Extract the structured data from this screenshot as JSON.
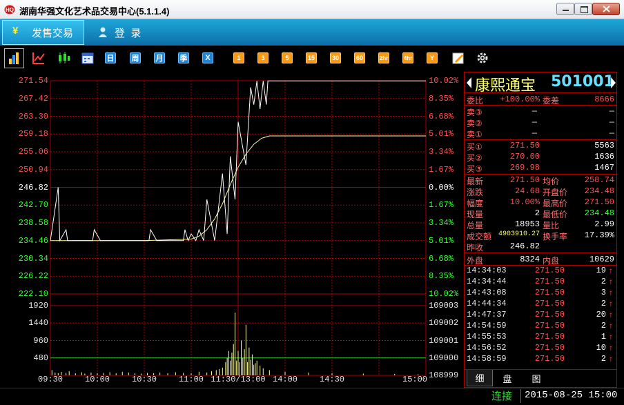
{
  "window": {
    "title": "湖南华强文化艺术品交易中心(5.1.1.4)"
  },
  "tabs": [
    {
      "label": "发售交易",
      "icon": "yen-icon"
    },
    {
      "label": "登  录",
      "icon": "user-icon"
    }
  ],
  "toolbar": {
    "period_buttons": [
      "日",
      "周",
      "月",
      "季",
      "X"
    ],
    "minute_buttons": [
      "1",
      "3",
      "5",
      "15",
      "30",
      "60",
      "2hr",
      "4hr",
      "Y"
    ]
  },
  "colors": {
    "up": "#ff5050",
    "down": "#33ff33",
    "price_line": "#ffffff",
    "avg_line": "#ffff99",
    "grid": "#b00000",
    "volume": "#ffff99"
  },
  "chart_data": {
    "type": "line",
    "title": "",
    "x_ticks": [
      "09:30",
      "10:00",
      "10:30",
      "11:00",
      "11:30/13:00",
      "14:00",
      "14:30",
      "15:00"
    ],
    "price_ticks": [
      "271.54",
      "267.42",
      "263.30",
      "259.18",
      "255.06",
      "250.94",
      "246.82",
      "242.70",
      "238.58",
      "234.46",
      "230.34",
      "226.22",
      "222.10"
    ],
    "pct_ticks": [
      "10.02%",
      "8.35%",
      "6.68%",
      "5.01%",
      "3.34%",
      "1.67%",
      "0.00%",
      "1.67%",
      "3.34%",
      "5.01%",
      "6.68%",
      "8.35%",
      "10.02%"
    ],
    "ylim": [
      222.1,
      271.54
    ],
    "prev_close": 246.82,
    "series": [
      {
        "x": [
          0,
          5,
          6,
          10,
          11,
          27,
          28,
          32,
          33,
          63,
          64,
          68,
          69,
          85,
          86,
          88,
          90,
          93,
          95,
          98,
          100,
          105,
          110,
          113,
          115,
          118,
          120,
          125,
          128,
          130,
          132,
          134,
          136,
          138,
          139,
          140,
          145,
          150,
          160,
          165,
          240
        ],
        "values": [
          234.46,
          246.82,
          234.46,
          237.0,
          234.46,
          234.46,
          237.0,
          234.46,
          234.46,
          234.46,
          237.0,
          234.46,
          234.46,
          234.46,
          237.0,
          234.46,
          236.0,
          234.46,
          237.0,
          234.46,
          244.0,
          234.46,
          250.0,
          236.0,
          254.0,
          244.0,
          262.0,
          252.0,
          270.0,
          266.0,
          271.5,
          265.0,
          271.5,
          266.0,
          271.5,
          271.5,
          271.5,
          271.5,
          271.5,
          271.5,
          271.5
        ]
      },
      {
        "x": [
          0,
          60,
          90,
          95,
          100,
          105,
          110,
          115,
          120,
          125,
          130,
          135,
          140,
          145,
          150,
          240
        ],
        "values": [
          234.46,
          234.46,
          234.8,
          235.5,
          237.0,
          239.5,
          243.0,
          247.5,
          251.5,
          254.5,
          256.8,
          258.2,
          258.74,
          258.74,
          258.74,
          258.74
        ]
      }
    ],
    "volume": {
      "ylabel_ticks": [
        "1920",
        "1440",
        "960",
        "480"
      ],
      "ylim": [
        0,
        2000
      ],
      "right_ticks": [
        "109003",
        "109002",
        "109001",
        "109000",
        "108999"
      ],
      "x": [
        1,
        3,
        5,
        7,
        10,
        12,
        16,
        20,
        22,
        26,
        30,
        34,
        38,
        42,
        46,
        50,
        54,
        58,
        62,
        66,
        70,
        75,
        80,
        85,
        90,
        95,
        100,
        103,
        106,
        108,
        110,
        112,
        113,
        114,
        115,
        116,
        117,
        118,
        119,
        120,
        121,
        122,
        123,
        124,
        125,
        126,
        127,
        128,
        129,
        130,
        131,
        132,
        134,
        136,
        140,
        150,
        165,
        180,
        200,
        220,
        235
      ],
      "values": [
        150,
        80,
        60,
        100,
        70,
        120,
        60,
        90,
        50,
        80,
        60,
        70,
        90,
        60,
        100,
        80,
        60,
        50,
        70,
        60,
        80,
        60,
        90,
        70,
        60,
        100,
        80,
        120,
        150,
        180,
        220,
        380,
        500,
        700,
        420,
        650,
        900,
        1800,
        420,
        700,
        380,
        1000,
        500,
        750,
        1450,
        380,
        800,
        450,
        600,
        300,
        350,
        420,
        280,
        200,
        150,
        100,
        80,
        60,
        50,
        40,
        30
      ]
    }
  },
  "quote": {
    "name": "康熙通宝",
    "code": "501001",
    "weibi_label": "委比",
    "weibi": "+100.00%",
    "weicha_label": "委差",
    "weicha": "8666",
    "asks": [
      {
        "label": "卖③",
        "price": "—",
        "vol": "—"
      },
      {
        "label": "卖②",
        "price": "—",
        "vol": "—"
      },
      {
        "label": "卖①",
        "price": "—",
        "vol": "—"
      }
    ],
    "bids": [
      {
        "label": "买①",
        "price": "271.50",
        "vol": "5563"
      },
      {
        "label": "买②",
        "price": "270.00",
        "vol": "1636"
      },
      {
        "label": "买③",
        "price": "269.98",
        "vol": "1467"
      }
    ],
    "stats": [
      {
        "l1": "最新",
        "v1": "271.50",
        "l2": "均价",
        "v2": "258.74"
      },
      {
        "l1": "涨跌",
        "v1": "24.68",
        "l2": "开盘价",
        "v2": "234.48"
      },
      {
        "l1": "幅度",
        "v1": "10.00%",
        "l2": "最高价",
        "v2": "271.50"
      },
      {
        "l1": "现量",
        "v1": "2",
        "l2": "最低价",
        "v2": "234.48"
      },
      {
        "l1": "总量",
        "v1": "18953",
        "l2": "量比",
        "v2": "2.99"
      },
      {
        "l1": "成交额",
        "v1": "4903910.27",
        "l2": "换手率",
        "v2": "17.39%"
      },
      {
        "l1": "昨收",
        "v1": "246.82",
        "l2": "",
        "v2": ""
      }
    ],
    "outer_label": "外盘",
    "outer": "8324",
    "inner_label": "内盘",
    "inner": "10629",
    "trades": [
      {
        "time": "14:34:03",
        "price": "271.50",
        "vol": "19"
      },
      {
        "time": "14:34:44",
        "price": "271.50",
        "vol": "2"
      },
      {
        "time": "14:43:08",
        "price": "271.50",
        "vol": "3"
      },
      {
        "time": "14:44:34",
        "price": "271.50",
        "vol": "2"
      },
      {
        "time": "14:47:37",
        "price": "271.50",
        "vol": "20"
      },
      {
        "time": "14:54:59",
        "price": "271.50",
        "vol": "2"
      },
      {
        "time": "14:55:53",
        "price": "271.50",
        "vol": "1"
      },
      {
        "time": "14:56:52",
        "price": "271.50",
        "vol": "10"
      },
      {
        "time": "14:58:59",
        "price": "271.50",
        "vol": "2"
      }
    ],
    "bottom_tabs": [
      "细",
      "盘",
      "图"
    ]
  },
  "status": {
    "connection": "连接",
    "datetime": "2015-08-25 15:00"
  }
}
